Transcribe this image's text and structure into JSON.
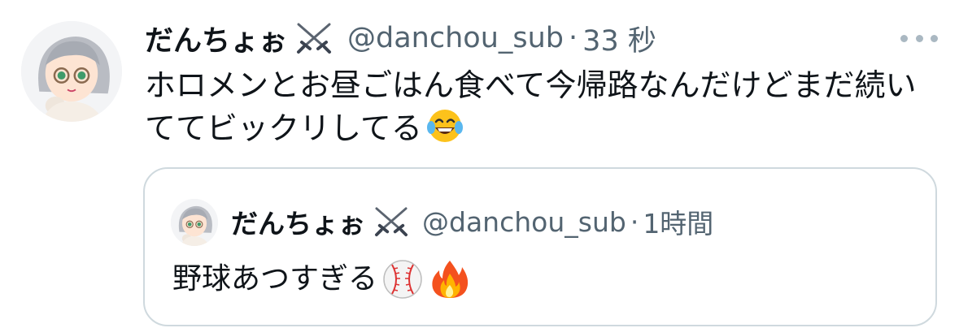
{
  "tweet": {
    "author_name": "だんちょぉ",
    "handle": "@danchou_sub",
    "separator": "·",
    "time": "33 秒",
    "text": "ホロメンとお昼ごはん食べて今帰路なんだけどまだ続いててビックリしてる",
    "text_emoji": "face-with-tears-of-joy-icon"
  },
  "quote": {
    "author_name": "だんちょぉ",
    "handle": "@danchou_sub",
    "separator": "·",
    "time": "1時間",
    "text": "野球あつすぎる",
    "emojis": [
      "baseball-icon",
      "fire-icon"
    ]
  },
  "colors": {
    "text": "#0f1419",
    "secondary": "#536471",
    "border": "#cfd9de",
    "more_dots": "#aab8c2"
  }
}
